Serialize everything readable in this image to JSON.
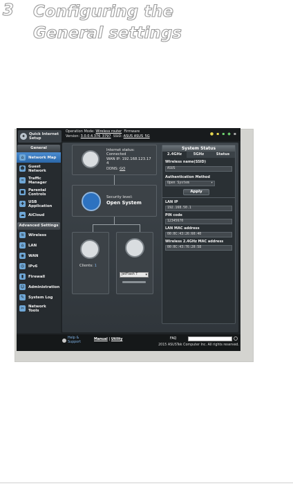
{
  "heading": {
    "number": "3",
    "title": "Configuring the General settings"
  },
  "header": {
    "qis_label": "Quick Internet Setup",
    "op_mode_label": "Operation Mode:",
    "op_mode_value": "Wireless router",
    "firmware_label": "Firmware",
    "version_label": "Version:",
    "version_value": "3.0.0.4.376_3797",
    "ssid_label": "SSID:",
    "ssid_value": "ASUS ASUS_5G"
  },
  "sidebar": {
    "general_title": "General",
    "items": [
      {
        "label": "Network Map",
        "icon": "network-map-icon"
      },
      {
        "label": "Guest Network",
        "icon": "guest-network-icon"
      },
      {
        "label": "Traffic Manager",
        "icon": "traffic-manager-icon"
      },
      {
        "label": "Parental Controls",
        "icon": "parental-controls-icon"
      },
      {
        "label": "USB Application",
        "icon": "usb-application-icon"
      },
      {
        "label": "AiCloud",
        "icon": "aicloud-icon"
      }
    ],
    "advanced_title": "Advanced Settings",
    "advanced_items": [
      {
        "label": "Wireless",
        "icon": "wireless-icon"
      },
      {
        "label": "LAN",
        "icon": "lan-icon"
      },
      {
        "label": "WAN",
        "icon": "wan-icon"
      },
      {
        "label": "IPv6",
        "icon": "ipv6-icon"
      },
      {
        "label": "Firewall",
        "icon": "firewall-icon"
      },
      {
        "label": "Administration",
        "icon": "administration-icon"
      },
      {
        "label": "System Log",
        "icon": "system-log-icon"
      },
      {
        "label": "Network Tools",
        "icon": "network-tools-icon"
      }
    ]
  },
  "map": {
    "internet_status_label": "Internet status:",
    "internet_status_value": "Connected",
    "wan_ip_label": "WAN IP: 192.168.123.17",
    "wan_ip_suffix": "4",
    "ddns_label": "DDNS:",
    "ddns_link": "GO",
    "security_label": "Security level:",
    "security_value": "Open System",
    "clients_label": "Clients:",
    "clients_count": "1",
    "usb_device": "JetFlash T"
  },
  "status": {
    "title": "System Status",
    "tabs": [
      "2.4GHz",
      "5GHz",
      "Status"
    ],
    "wireless_name_label": "Wireless name(SSID)",
    "wireless_name_value": "ASUS",
    "auth_label": "Authentication Method",
    "auth_value": "Open System",
    "apply_label": "Apply",
    "lan_ip_label": "LAN IP",
    "lan_ip_value": "192.168.50.1",
    "pin_label": "PIN code",
    "pin_value": "12345670",
    "lan_mac_label": "LAN MAC address",
    "lan_mac_value": "00:0C:43:26:60:40",
    "wl_mac_label": "Wireless 2.4GHz MAC address",
    "wl_mac_value": "00:0C:43:76:20:58"
  },
  "footer": {
    "help_label": "Help & Support",
    "manual_label": "Manual",
    "separator": "|",
    "utility_label": "Utility",
    "faq_label": "FAQ",
    "copyright": "2015 ASUSTek Computer Inc. All rights reserved."
  }
}
